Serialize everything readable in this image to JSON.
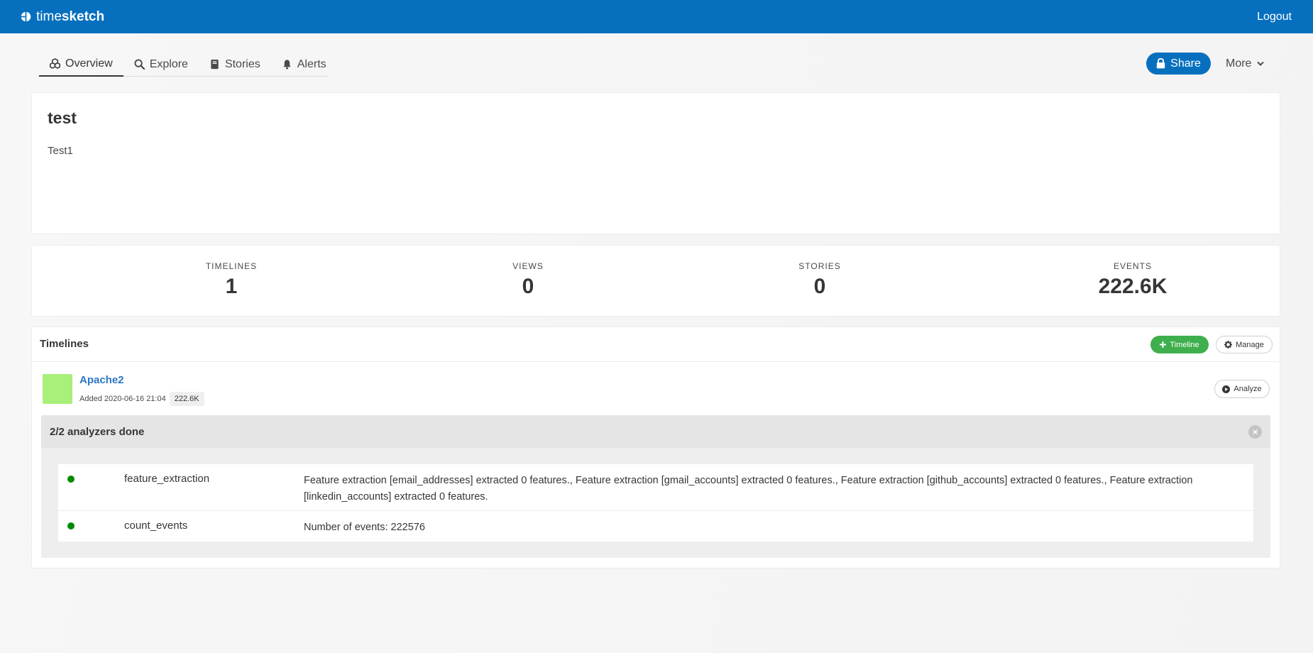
{
  "navbar": {
    "brand_light": "time",
    "brand_bold": "sketch",
    "logout_label": "Logout"
  },
  "tabs": [
    {
      "label": "Overview",
      "icon": "cubes-icon",
      "active": true
    },
    {
      "label": "Explore",
      "icon": "search-icon",
      "active": false
    },
    {
      "label": "Stories",
      "icon": "book-icon",
      "active": false
    },
    {
      "label": "Alerts",
      "icon": "bell-icon",
      "active": false
    }
  ],
  "actions": {
    "share_label": "Share",
    "more_label": "More"
  },
  "sketch": {
    "title": "test",
    "description": "Test1"
  },
  "stats": [
    {
      "label": "TIMELINES",
      "value": "1"
    },
    {
      "label": "VIEWS",
      "value": "0"
    },
    {
      "label": "STORIES",
      "value": "0"
    },
    {
      "label": "EVENTS",
      "value": "222.6K"
    }
  ],
  "timelines": {
    "title": "Timelines",
    "add_label": "Timeline",
    "manage_label": "Manage",
    "items": [
      {
        "name": "Apache2",
        "added": "Added 2020-06-16 21:04",
        "count": "222.6K",
        "color": "#a8f07a",
        "analyze_label": "Analyze"
      }
    ]
  },
  "analyzers": {
    "title": "2/2 analyzers done",
    "status_color": "#008a00",
    "rows": [
      {
        "name": "feature_extraction",
        "result": "Feature extraction [email_addresses] extracted 0 features., Feature extraction [gmail_accounts] extracted 0 features., Feature extraction [github_accounts] extracted 0 features., Feature extraction [linkedin_accounts] extracted 0 features."
      },
      {
        "name": "count_events",
        "result": "Number of events: 222576"
      }
    ]
  },
  "colors": {
    "primary": "#0670bf",
    "success": "#3eaf4c"
  }
}
